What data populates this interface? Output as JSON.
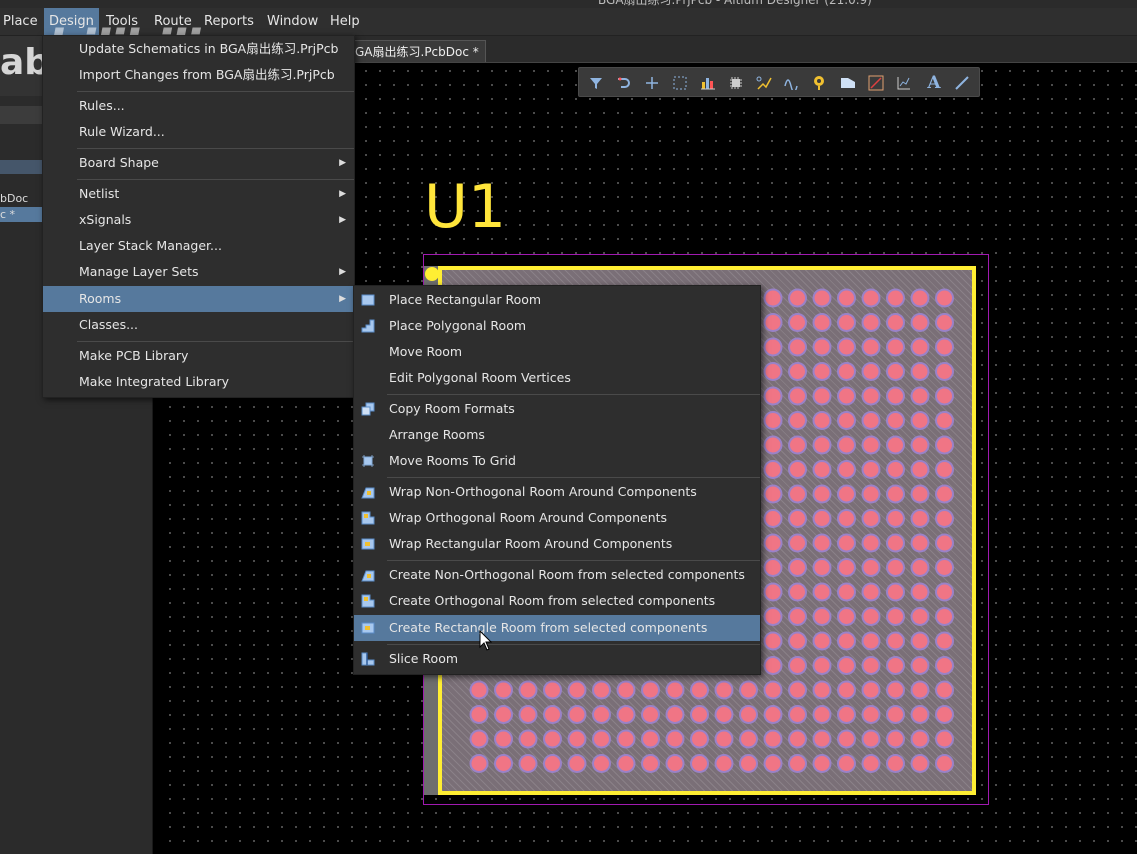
{
  "title_partial": "BGA扇出练习.PrjPcb - Altium Designer (21.0.9)",
  "menubar": {
    "items": [
      {
        "label": "Place",
        "ul": "P"
      },
      {
        "label": "Design",
        "ul": "D"
      },
      {
        "label": "Tools",
        "ul": "o"
      },
      {
        "label": "Route",
        "ul": ""
      },
      {
        "label": "Reports",
        "ul": "R"
      },
      {
        "label": "Window",
        "ul": "W"
      },
      {
        "label": "Help",
        "ul": "H"
      }
    ]
  },
  "left_panel": {
    "files": [
      "bDoc",
      "c *"
    ],
    "watermark": "ab",
    "logo": "bilibili"
  },
  "doc_tab": {
    "label": "GA扇出练习.PcbDoc *"
  },
  "canvas": {
    "designator": "U1"
  },
  "design_menu": {
    "items": [
      {
        "label": "Update Schematics in BGA扇出练习.PrjPcb"
      },
      {
        "label": "Import Changes from BGA扇出练习.PrjPcb"
      },
      {
        "label": "Rules..."
      },
      {
        "label": "Rule Wizard..."
      },
      {
        "label": "Board Shape"
      },
      {
        "label": "Netlist"
      },
      {
        "label": "xSignals"
      },
      {
        "label": "Layer Stack Manager..."
      },
      {
        "label": "Manage Layer Sets"
      },
      {
        "label": "Rooms"
      },
      {
        "label": "Classes..."
      },
      {
        "label": "Make PCB Library"
      },
      {
        "label": "Make Integrated Library"
      }
    ]
  },
  "rooms_menu": {
    "items": [
      {
        "label": "Place Rectangular Room",
        "icon": "rect-room-icon"
      },
      {
        "label": "Place Polygonal Room",
        "icon": "poly-room-icon"
      },
      {
        "label": "Move Room",
        "icon": ""
      },
      {
        "label": "Edit Polygonal Room Vertices",
        "icon": ""
      },
      {
        "label": "Copy Room Formats",
        "icon": "copy-room-icon"
      },
      {
        "label": "Arrange Rooms",
        "icon": ""
      },
      {
        "label": "Move Rooms To Grid",
        "icon": "grid-room-icon"
      },
      {
        "label": "Wrap Non-Orthogonal Room Around Components",
        "icon": "wrap-nonortho-icon"
      },
      {
        "label": "Wrap Orthogonal Room Around Components",
        "icon": "wrap-ortho-icon"
      },
      {
        "label": "Wrap Rectangular Room Around Components",
        "icon": "wrap-rect-icon"
      },
      {
        "label": "Create Non-Orthogonal Room from selected components",
        "icon": "create-nonortho-icon"
      },
      {
        "label": "Create Orthogonal Room from selected components",
        "icon": "create-ortho-icon"
      },
      {
        "label": "Create Rectangle Room from selected components",
        "icon": "create-rect-icon"
      },
      {
        "label": "Slice Room",
        "icon": "slice-room-icon"
      }
    ]
  },
  "toolbar": {
    "icons": [
      "filter-icon",
      "route-icon",
      "cross-icon",
      "select-rect-icon",
      "chart-icon",
      "component-icon",
      "interactive-route-icon",
      "diff-pair-icon",
      "via-icon",
      "fill-icon",
      "polygon-icon",
      "graph-icon",
      "text-icon",
      "line-icon"
    ]
  },
  "colors": {
    "accent": "#56799d",
    "silkscreen": "#ffee33",
    "pad": "#f07585",
    "room": "#a01ab0"
  }
}
